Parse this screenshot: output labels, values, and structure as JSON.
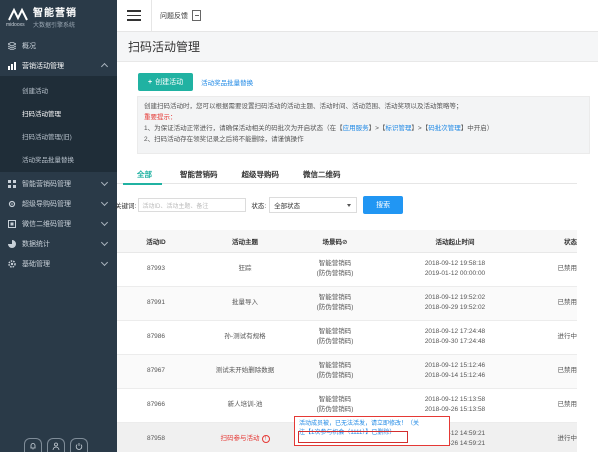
{
  "brand": {
    "name": "智能营销",
    "sub": "大数据引擎系统",
    "small": "midooxs"
  },
  "topbar": {
    "feedback_label": "问题反馈"
  },
  "sidebar": {
    "items": [
      {
        "label": "概况"
      },
      {
        "label": "营销活动管理"
      },
      {
        "label": "智能营销码管理"
      },
      {
        "label": "超级导购码管理"
      },
      {
        "label": "微信二维码管理"
      },
      {
        "label": "数据统计"
      },
      {
        "label": "基础管理"
      }
    ],
    "sub_items": [
      {
        "label": "创建活动"
      },
      {
        "label": "扫码活动管理"
      },
      {
        "label": "扫码活动管理(旧)"
      },
      {
        "label": "活动奖品批量替换"
      }
    ]
  },
  "page": {
    "title": "扫码活动管理"
  },
  "actions": {
    "create_label": "创建活动",
    "create_plus": "+",
    "batch_label": "活动奖品批量替换"
  },
  "tips": {
    "line1": "创建扫码活动时，您可以根据需要设置扫码活动的活动主题、活动时间、活动范围、活动奖项以及活动策略等；",
    "warn": "重要提示：",
    "line2_a": "1、为保证活动正常进行，请确保活动相关的码批次为开启状态（在【",
    "line2_l1": "应用服务",
    "line2_b": "】>【",
    "line2_l2": "标识管理",
    "line2_c": "】>【",
    "line2_l3": "码批次管理",
    "line2_d": "】中开启）",
    "line3": "2、扫码活动存在领奖记录之后将不能删除，请谨慎操作"
  },
  "tabs": [
    {
      "label": "全部"
    },
    {
      "label": "智能营销码"
    },
    {
      "label": "超级导购码"
    },
    {
      "label": "微信二维码"
    }
  ],
  "filters": {
    "keyword_label": "关键词:",
    "keyword_placeholder": "活动ID、活动主题、备注",
    "status_label": "状态:",
    "status_value": "全部状态",
    "search_label": "搜索"
  },
  "table": {
    "headers": {
      "id": "活动ID",
      "name": "活动主题",
      "type": "场景码⊘",
      "time": "活动起止时间",
      "status": "状态"
    },
    "rows": [
      {
        "id": "87993",
        "name": "狂踪",
        "type1": "智能营销码",
        "type2": "(防伪营销码)",
        "start": "2018-09-12 19:58:18",
        "end": "2019-01-12 00:00:00",
        "status": "已禁用"
      },
      {
        "id": "87991",
        "name": "批量导入",
        "type1": "智能营销码",
        "type2": "(防伪营销码)",
        "start": "2018-09-12 19:52:02",
        "end": "2018-09-29 19:52:02",
        "status": "已禁用"
      },
      {
        "id": "87986",
        "name": "孙-测试有规格",
        "type1": "智能营销码",
        "type2": "(防伪营销码)",
        "start": "2018-09-12 17:24:48",
        "end": "2018-09-30 17:24:48",
        "status": "进行中"
      },
      {
        "id": "87967",
        "name": "测试未开始删除数据",
        "type1": "智能营销码",
        "type2": "(防伪营销码)",
        "start": "2018-09-12 15:12:46",
        "end": "2018-09-14 15:12:46",
        "status": "已禁用"
      },
      {
        "id": "87966",
        "name": "新人培训-池",
        "type1": "智能营销码",
        "type2": "(防伪营销码)",
        "start": "2018-09-12 15:13:58",
        "end": "2018-09-26 15:13:58",
        "status": "已禁用"
      },
      {
        "id": "87958",
        "name": "扫码参与活动",
        "type1": "",
        "type2": "",
        "start": "2018-09-12 14:59:21",
        "end": "2018-09-26 14:59:21",
        "status": "进行中"
      }
    ]
  },
  "tooltip": {
    "line1": "活动成员被，已无法活发，请立即修改！（关",
    "line2_a": "注【1次参与机会（1111）】已删除）",
    "line2_grey": ""
  }
}
